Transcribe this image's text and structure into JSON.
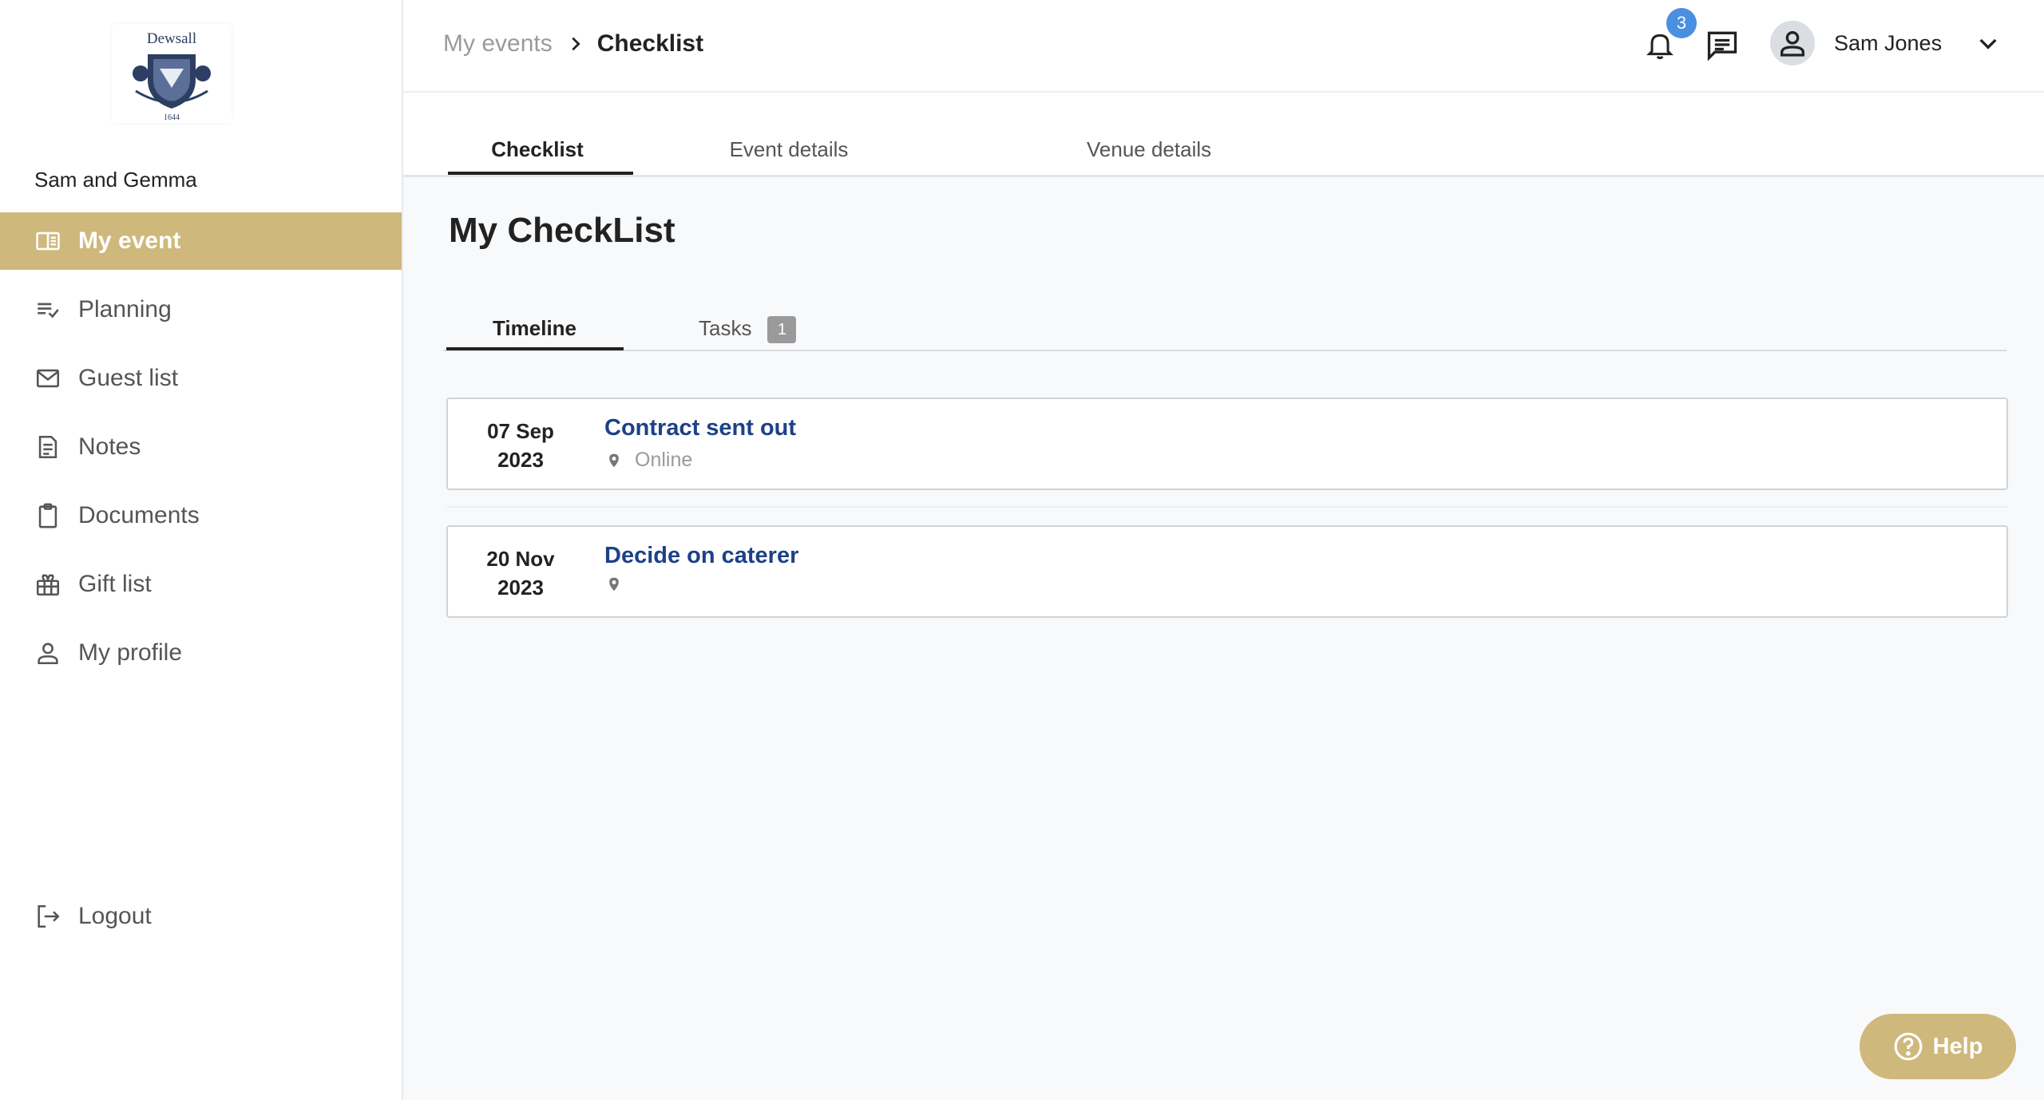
{
  "sidebar": {
    "logo_text": "Dewsall",
    "logo_year": "1644",
    "event_name": "Sam and Gemma",
    "items": [
      {
        "label": "My event",
        "icon": "book-open-icon",
        "active": true
      },
      {
        "label": "Planning",
        "icon": "checklist-icon",
        "active": false
      },
      {
        "label": "Guest list",
        "icon": "mail-icon",
        "active": false
      },
      {
        "label": "Notes",
        "icon": "note-icon",
        "active": false
      },
      {
        "label": "Documents",
        "icon": "clipboard-icon",
        "active": false
      },
      {
        "label": "Gift list",
        "icon": "gift-icon",
        "active": false
      },
      {
        "label": "My profile",
        "icon": "person-icon",
        "active": false
      }
    ],
    "logout_label": "Logout"
  },
  "header": {
    "breadcrumb_parent": "My events",
    "breadcrumb_current": "Checklist",
    "notification_count": "3",
    "user_name": "Sam Jones"
  },
  "tabs": [
    "Checklist",
    "Event details",
    "Venue details"
  ],
  "page_title": "My CheckList",
  "subtabs": {
    "timeline": "Timeline",
    "tasks": "Tasks",
    "tasks_count": "1"
  },
  "events": [
    {
      "day": "07 Sep",
      "year": "2023",
      "title": "Contract sent out",
      "location": "Online"
    },
    {
      "day": "20 Nov",
      "year": "2023",
      "title": "Decide on caterer",
      "location": ""
    }
  ],
  "help_label": "Help",
  "colors": {
    "accent": "#cfb87c",
    "link": "#1c4187",
    "badge": "#4a8fe0"
  }
}
